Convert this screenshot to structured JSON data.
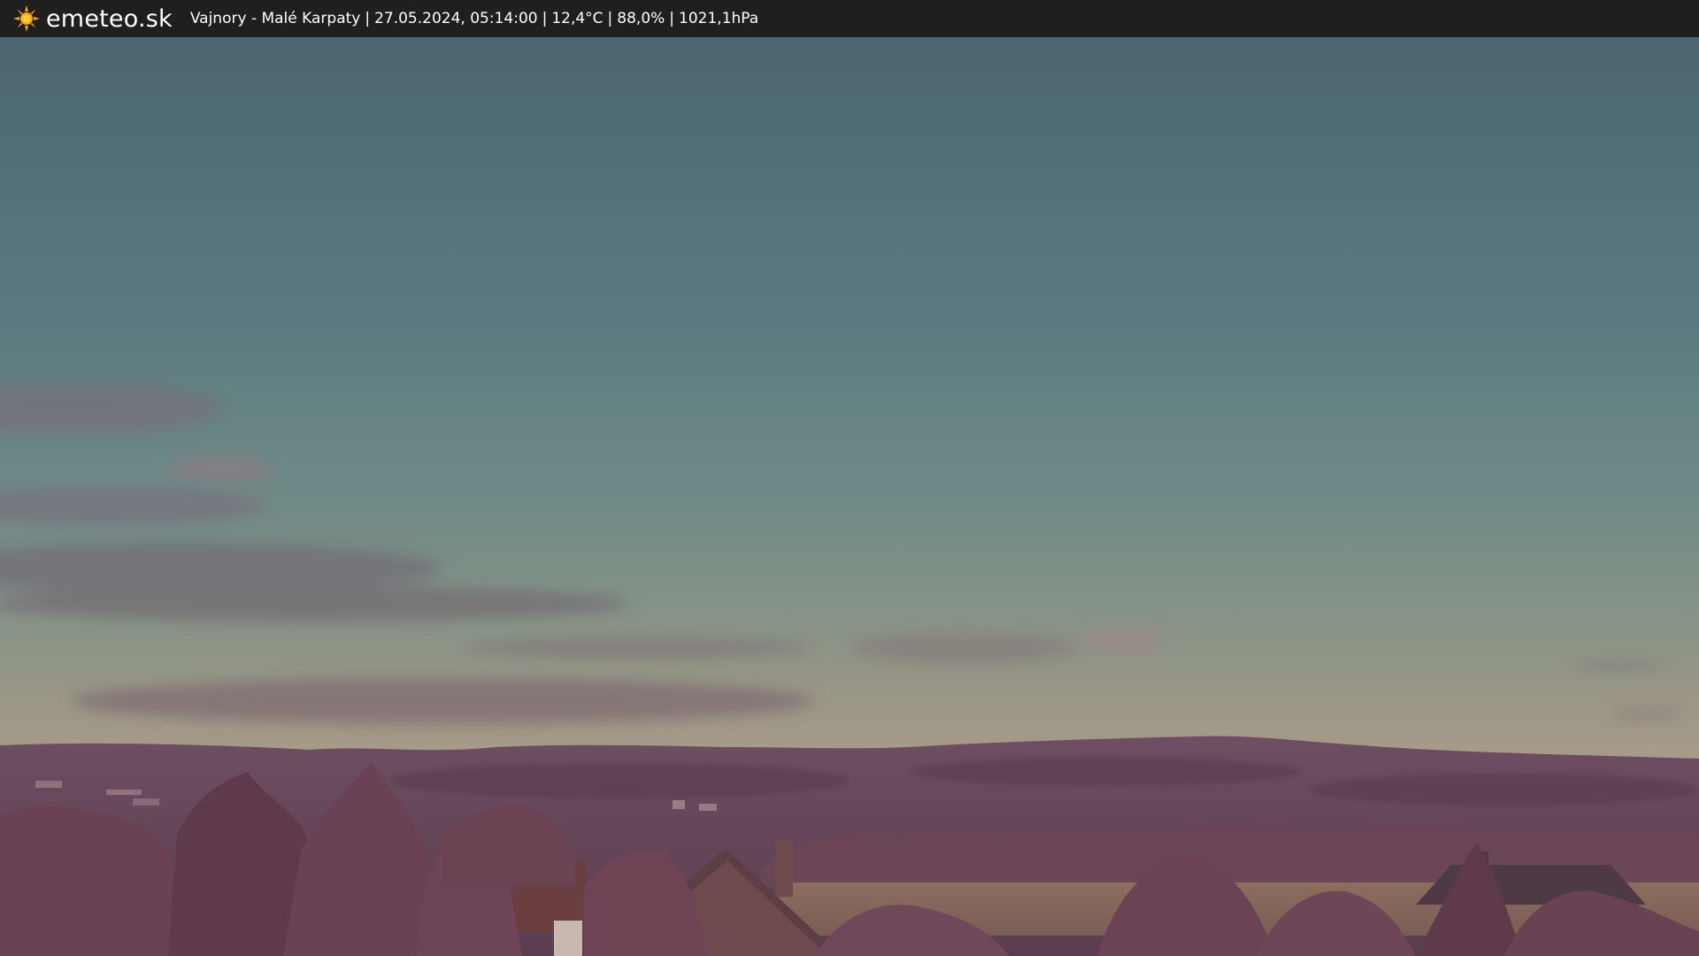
{
  "header": {
    "brand": "emeteo.sk",
    "logo_icon": "sun-icon",
    "location": "Vajnory - Malé Karpaty",
    "datetime": "27.05.2024, 05:14:00",
    "temperature": "12,4°C",
    "humidity": "88,0%",
    "pressure": "1021,1hPa",
    "separator": "|"
  },
  "colors": {
    "bar_background": "#1f1f1f",
    "sun_icon": "#f5a623",
    "sky_top": "#4e6b76",
    "sky_mid": "#7a8f88",
    "sky_horizon": "#b09a88",
    "hills": "#6b4a5e",
    "trees": "#6e4656",
    "field": "#8c6f5e"
  }
}
